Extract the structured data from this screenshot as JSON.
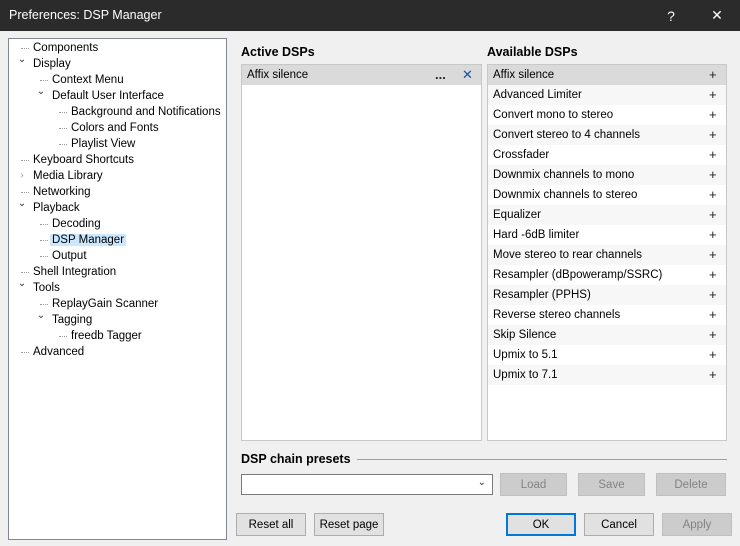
{
  "window": {
    "title": "Preferences: DSP Manager",
    "help": "?",
    "close": "✕"
  },
  "tree": [
    {
      "label": "Components",
      "level": 0,
      "exp": ""
    },
    {
      "label": "Display",
      "level": 0,
      "exp": "open"
    },
    {
      "label": "Context Menu",
      "level": 1,
      "exp": ""
    },
    {
      "label": "Default User Interface",
      "level": 1,
      "exp": "open"
    },
    {
      "label": "Background and Notifications",
      "level": 2,
      "exp": ""
    },
    {
      "label": "Colors and Fonts",
      "level": 2,
      "exp": ""
    },
    {
      "label": "Playlist View",
      "level": 2,
      "exp": ""
    },
    {
      "label": "Keyboard Shortcuts",
      "level": 0,
      "exp": ""
    },
    {
      "label": "Media Library",
      "level": 0,
      "exp": "closed"
    },
    {
      "label": "Networking",
      "level": 0,
      "exp": ""
    },
    {
      "label": "Playback",
      "level": 0,
      "exp": "open"
    },
    {
      "label": "Decoding",
      "level": 1,
      "exp": ""
    },
    {
      "label": "DSP Manager",
      "level": 1,
      "exp": "",
      "selected": true
    },
    {
      "label": "Output",
      "level": 1,
      "exp": ""
    },
    {
      "label": "Shell Integration",
      "level": 0,
      "exp": ""
    },
    {
      "label": "Tools",
      "level": 0,
      "exp": "open"
    },
    {
      "label": "ReplayGain Scanner",
      "level": 1,
      "exp": ""
    },
    {
      "label": "Tagging",
      "level": 1,
      "exp": "open"
    },
    {
      "label": "freedb Tagger",
      "level": 2,
      "exp": ""
    },
    {
      "label": "Advanced",
      "level": 0,
      "exp": ""
    }
  ],
  "active": {
    "heading": "Active DSPs",
    "items": [
      {
        "label": "Affix silence",
        "config": "...",
        "remove": "✕"
      }
    ]
  },
  "available": {
    "heading": "Available DSPs",
    "add": "+",
    "items": [
      "Affix silence",
      "Advanced Limiter",
      "Convert mono to stereo",
      "Convert stereo to 4 channels",
      "Crossfader",
      "Downmix channels to mono",
      "Downmix channels to stereo",
      "Equalizer",
      "Hard -6dB limiter",
      "Move stereo to rear channels",
      "Resampler (dBpoweramp/SSRC)",
      "Resampler (PPHS)",
      "Reverse stereo channels",
      "Skip Silence",
      "Upmix to 5.1",
      "Upmix to 7.1"
    ]
  },
  "presets": {
    "heading": "DSP chain presets",
    "value": "",
    "load": "Load",
    "save": "Save",
    "delete": "Delete"
  },
  "footer": {
    "reset_all": "Reset all",
    "reset_page": "Reset page",
    "ok": "OK",
    "cancel": "Cancel",
    "apply": "Apply"
  }
}
